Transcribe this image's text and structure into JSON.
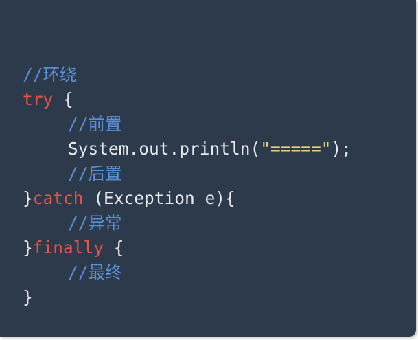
{
  "code": {
    "line1": {
      "comment": "//环绕"
    },
    "line2": {
      "keyword": "try",
      "rest": " {"
    },
    "line3": {
      "comment": "//前置"
    },
    "line4": {
      "call": "System.out.println(",
      "string": "\"=====\"",
      "end": ");"
    },
    "line5": {
      "comment": "//后置"
    },
    "line6": {
      "brace": "}",
      "keyword": "catch",
      "rest": " (Exception e){"
    },
    "line7": {
      "comment": "//异常"
    },
    "line8": {
      "brace": "}",
      "keyword": "finally",
      "rest": " {"
    },
    "line9": {
      "comment": "//最终"
    },
    "line10": {
      "brace": "}"
    }
  },
  "colors": {
    "background": "#2d3a4b",
    "keyword": "#e5534b",
    "comment": "#5b8fd8",
    "string": "#e6d37a",
    "text": "#e6e9ee"
  }
}
